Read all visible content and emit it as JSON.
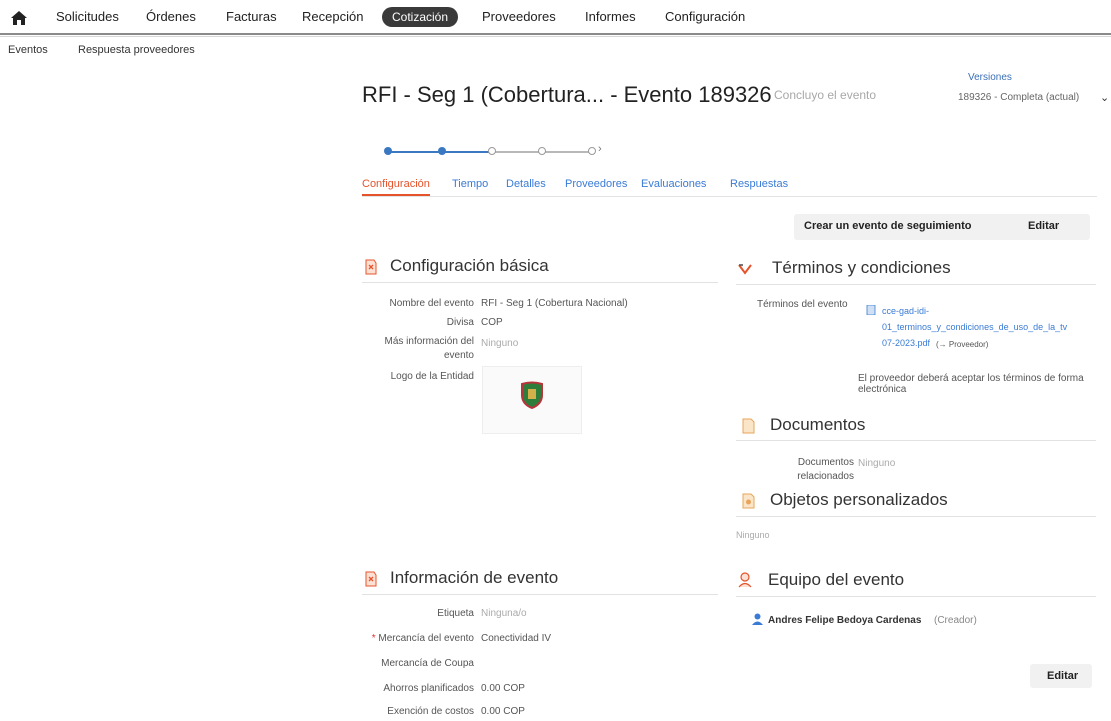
{
  "nav": {
    "items": [
      "Solicitudes",
      "Órdenes",
      "Facturas",
      "Recepción",
      "Cotización",
      "Proveedores",
      "Informes",
      "Configuración"
    ],
    "active": "Cotización"
  },
  "subnav": [
    "Eventos",
    "Respuesta proveedores"
  ],
  "header": {
    "title": "RFI - Seg 1 (Cobertura... - Evento 189326",
    "status": "Concluyo el evento",
    "versions_label": "Versiones",
    "versions_value": "189326 - Completa (actual)"
  },
  "tabs": [
    "Configuración",
    "Tiempo",
    "Detalles",
    "Proveedores",
    "Evaluaciones",
    "Respuestas"
  ],
  "actions": {
    "follow_up": "Crear un evento de seguimiento",
    "edit": "Editar"
  },
  "basic": {
    "title": "Configuración básica",
    "event_name_label": "Nombre del evento",
    "event_name_value": "RFI - Seg 1 (Cobertura Nacional)",
    "currency_label": "Divisa",
    "currency_value": "COP",
    "more_info_label_1": "Más información del",
    "more_info_label_2": "evento",
    "more_info_value": "Ninguno",
    "logo_label": "Logo de la Entidad"
  },
  "terms": {
    "title": "Términos y condiciones",
    "label": "Términos del evento",
    "file_line1": "cce-gad-idi-",
    "file_line2": "01_terminos_y_condiciones_de_uso_de_la_tv",
    "file_line3": "07-2023.pdf",
    "file_tag": "(→ Proveedor)",
    "note": "El proveedor deberá aceptar los términos de forma",
    "note_2": "electrónica"
  },
  "documents": {
    "title": "Documentos",
    "label_1": "Documentos",
    "label_2": "relacionados",
    "value": "Ninguno"
  },
  "custom": {
    "title": "Objetos personalizados",
    "value": "Ninguno"
  },
  "event_info": {
    "title": "Información de evento",
    "tag_label": "Etiqueta",
    "tag_value": "Ninguna/o",
    "commodity_label": "Mercancía del evento",
    "commodity_value": "Conectividad IV",
    "coupa_label": "Mercancía de Coupa",
    "savings_label": "Ahorros planificados",
    "savings_value": "0.00 COP",
    "exemption_label": "Exención de costos",
    "exemption_value": "0.00 COP"
  },
  "team": {
    "title": "Equipo del evento",
    "member": "Andres Felipe Bedoya Cardenas",
    "role": "(Creador)",
    "edit": "Editar"
  },
  "colors": {
    "accent": "#e4532c",
    "link": "#3a7bd5",
    "active_nav": "#3a3a3a"
  }
}
